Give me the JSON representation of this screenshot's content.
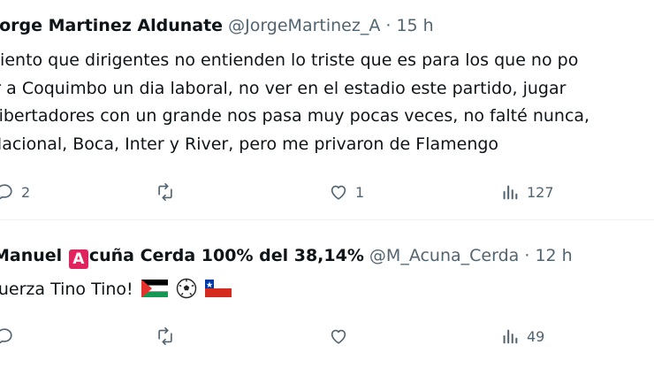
{
  "tweets": [
    {
      "display_name": "Jorge Martinez Aldunate",
      "handle": "@JorgeMartinez_A",
      "time": "15 h",
      "lines": [
        "Siento que dirigentes no entienden lo triste que es para los que no po",
        "ir a Coquimbo un dia laboral, no ver en el estadio este partido, jugar",
        "Libertadores con un grande nos pasa muy pocas veces, no falté nunca,",
        "Nacional, Boca, Inter y River, pero me privaron de Flamengo"
      ],
      "replies": "2",
      "retweets": "",
      "likes": "1",
      "views": "127"
    },
    {
      "display_name_pre": "Manuel",
      "badge_letter": "A",
      "display_name_post": "cuña Cerda 100% del 38,14%",
      "handle": "@M_Acuna_Cerda",
      "time": "12 h",
      "text": "Fuerza Tino Tino!",
      "emojis": [
        "palestine-flag",
        "soccer-ball",
        "chile-flag"
      ],
      "replies": "",
      "retweets": "",
      "likes": "",
      "views": "49"
    }
  ],
  "separator": "·",
  "colors": {
    "text": "#0f1419",
    "muted": "#536471",
    "badge": "#e0245e",
    "divider": "#eff3f4"
  },
  "icons": [
    "reply-icon",
    "retweet-icon",
    "like-icon",
    "views-icon"
  ]
}
